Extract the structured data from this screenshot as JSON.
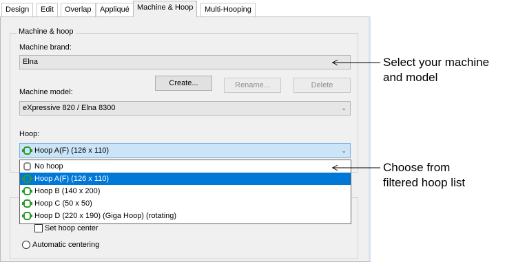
{
  "tabs": [
    "Design",
    "Edit",
    "Overlap",
    "Appliqué",
    "Machine & Hoop",
    "Multi-Hooping"
  ],
  "group_title": "Machine & hoop",
  "machine_brand": {
    "label": "Machine brand:",
    "value": "Elna"
  },
  "buttons": {
    "create": "Create...",
    "rename": "Rename...",
    "delete": "Delete"
  },
  "machine_model": {
    "label": "Machine model:",
    "value": "eXpressive 820 / Elna 8300"
  },
  "hoop": {
    "label": "Hoop:",
    "value": "Hoop A(F) (126 x 110)"
  },
  "hoop_list": [
    {
      "label": "No hoop",
      "icon": "no-hoop-icon",
      "selected": false
    },
    {
      "label": "Hoop A(F) (126 x 110)",
      "icon": "hoop-icon",
      "selected": true
    },
    {
      "label": "Hoop B (140 x 200)",
      "icon": "hoop-icon",
      "selected": false
    },
    {
      "label": "Hoop C (50 x 50)",
      "icon": "hoop-icon",
      "selected": false
    },
    {
      "label": "Hoop D (220 x 190) (Giga Hoop) (rotating)",
      "icon": "hoop-icon",
      "selected": false
    }
  ],
  "options": {
    "set_center": "Set hoop center",
    "auto_center": "Automatic centering"
  },
  "callouts": {
    "top_line1": "Select your machine",
    "top_line2": "and model",
    "bottom_line1": "Choose from",
    "bottom_line2": "filtered hoop list"
  }
}
